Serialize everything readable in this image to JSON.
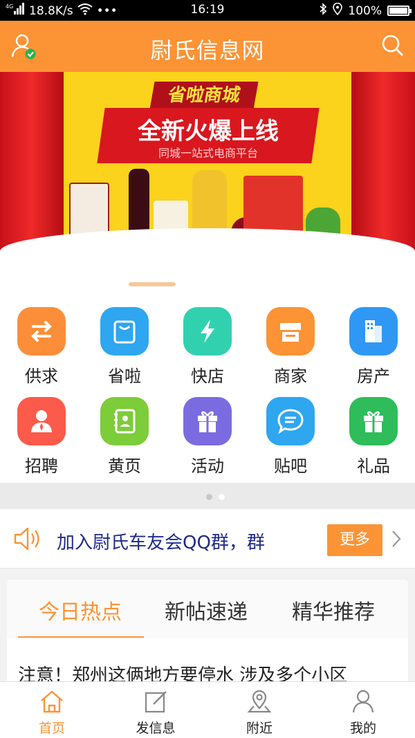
{
  "status_bar": {
    "network_label": "4G",
    "speed": "18.8K/s",
    "time": "16:19",
    "battery_text": "100%",
    "battery_level": 1.0
  },
  "header": {
    "title": "尉氏信息网",
    "user_icon": "user-verified-icon",
    "search_icon": "search-icon"
  },
  "banner": {
    "brand": "省啦商城",
    "headline": "全新火爆上线",
    "subline": "同城一站式电商平台",
    "slide_index": 1
  },
  "grid_items": [
    {
      "label": "供求",
      "icon": "swap-arrows-icon",
      "color": "#fc8e3a"
    },
    {
      "label": "省啦",
      "icon": "shopping-bag-icon",
      "color": "#2fa6f0"
    },
    {
      "label": "快店",
      "icon": "lightning-icon",
      "color": "#31d1b0"
    },
    {
      "label": "商家",
      "icon": "storefront-icon",
      "color": "#fc9335"
    },
    {
      "label": "房产",
      "icon": "building-icon",
      "color": "#2f98f5"
    },
    {
      "label": "招聘",
      "icon": "person-tie-icon",
      "color": "#fc5a4a"
    },
    {
      "label": "黄页",
      "icon": "contact-book-icon",
      "color": "#7dcc3a"
    },
    {
      "label": "活动",
      "icon": "gift-box-icon",
      "color": "#7a6ce0"
    },
    {
      "label": "贴吧",
      "icon": "chat-bubble-icon",
      "color": "#2fa6f0"
    },
    {
      "label": "礼品",
      "icon": "gift-icon",
      "color": "#2ebd5a"
    }
  ],
  "grid_page": 1,
  "notice": {
    "text": "加入尉氏车友会QQ群，群",
    "more_label": "更多"
  },
  "news": {
    "tabs": [
      "今日热点",
      "新帖速递",
      "精华推荐"
    ],
    "active_tab": 0,
    "first_headline": "注意！郑州这俩地方要停水 涉及多个小区"
  },
  "bottom_nav": [
    {
      "label": "首页",
      "icon": "home-icon",
      "active": true
    },
    {
      "label": "发信息",
      "icon": "edit-icon",
      "active": false
    },
    {
      "label": "附近",
      "icon": "location-pin-icon",
      "active": false
    },
    {
      "label": "我的",
      "icon": "user-icon",
      "active": false
    }
  ],
  "colors": {
    "accent": "#fc9335",
    "notice_text": "#1f2a8a"
  }
}
